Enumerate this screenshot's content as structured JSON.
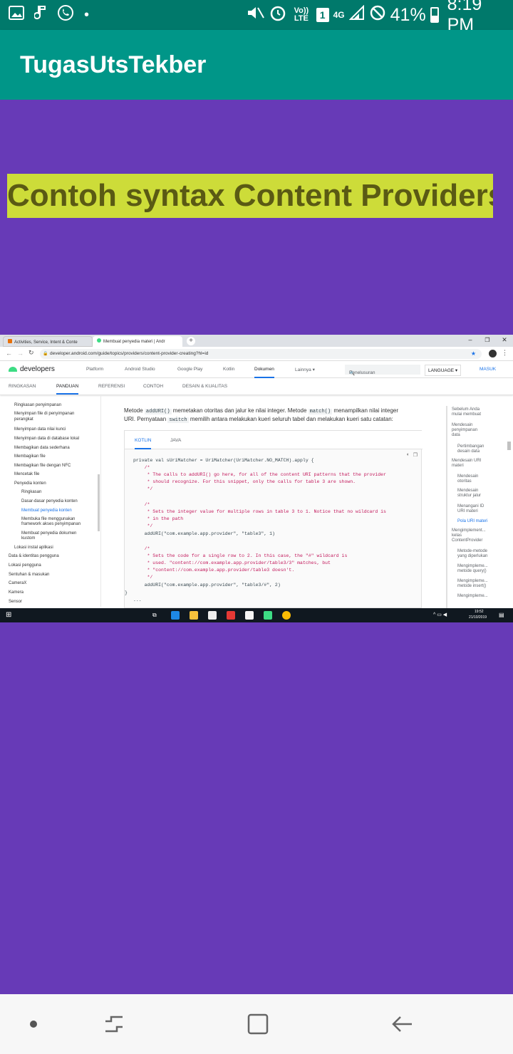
{
  "status_bar": {
    "battery": "41%",
    "time": "8:19 PM",
    "network": "4G",
    "volte": "Vo)) LTE",
    "sim": "1",
    "icons": [
      "gallery-icon",
      "music-note-icon",
      "whatsapp-icon",
      "dot-icon",
      "mute-icon",
      "alarm-icon",
      "volte-icon",
      "sim-icon",
      "signal-icon",
      "dnd-icon"
    ]
  },
  "app_bar": {
    "title": "TugasUtsTekber",
    "color": "#009688",
    "status_color": "#00796b"
  },
  "main": {
    "background": "#673ab7",
    "headline": "Contoh syntax Content Providers",
    "headline_bg": "#cddc39"
  },
  "browser": {
    "tabs": [
      {
        "label": "Activities, Service, Intent & Conte"
      },
      {
        "label": "Membuat penyedia materi | Andr"
      }
    ],
    "url": "developer.android.com/guide/topics/providers/content-provider-creating?hl=id",
    "site_nav": {
      "logo": "developers",
      "items": [
        "Platform",
        "Android Studio",
        "Google Play",
        "Kotlin",
        "Dokumen",
        "Lainnya ▾"
      ],
      "search_placeholder": "Penelusuran",
      "language": "LANGUAGE ▾",
      "signin": "MASUK"
    },
    "sub_nav": [
      "RINGKASAN",
      "PANDUAN",
      "REFERENSI",
      "CONTOH",
      "DESAIN & KUALITAS"
    ],
    "left_nav": [
      "Ringkasan penyimpanan",
      "Menyimpan file di penyimpanan",
      "perangkat",
      "Menyimpan data nilai kunci",
      "Menyimpan data di database lokal",
      "Membagikan data sederhana",
      "Membagikan file",
      "Membagikan file dengan NFC",
      "Mencetak file",
      "Penyedia konten",
      "Ringkasan",
      "Dasar-dasar penyedia konten",
      "Membuat penyedia konten",
      "Membuka file menggunakan",
      "framework akses penyimpanan",
      "Membuat penyedia dokumen",
      "kustom",
      "Lokasi instal aplikasi",
      "Data & identitas pengguna",
      "Lokasi pengguna",
      "Sentuhan & masukan",
      "CameraX",
      "Kamera",
      "Sensor"
    ],
    "content": {
      "para1_a": "Metode",
      "adduri": "addURI()",
      "para1_b": "memetakan otoritas dan jalur ke nilai integer. Metode",
      "match": "match()",
      "para1_c": "menampilkan nilai integer",
      "para2_a": "URI. Pernyataan",
      "switch": "switch",
      "para2_b": "memilih antara melakukan kueri seluruh tabel dan melakukan kueri satu catatan:",
      "code_tabs": [
        "KOTLIN",
        "JAVA"
      ],
      "code_lines": [
        "private val sUriMatcher = UriMatcher(UriMatcher.NO_MATCH).apply {",
        "    /*",
        "     * The calls to addURI() go here, for all of the content URI patterns that the provider",
        "     * should recognize. For this snippet, only the calls for table 3 are shown.",
        "     */",
        "",
        "    /*",
        "     * Sets the integer value for multiple rows in table 3 to 1. Notice that no wildcard is",
        "     * in the path",
        "     */",
        "    addURI(\"com.example.app.provider\", \"table3\", 1)",
        "",
        "    /*",
        "     * Sets the code for a single row to 2. In this case, the \"#\" wildcard is",
        "     * used. \"content://com.example.app.provider/table3/3\" matches, but",
        "     * \"content://com.example.app.provider/table3 doesn't.",
        "     */",
        "    addURI(\"com.example.app.provider\", \"table3/#\", 2)",
        "}",
        "..."
      ]
    },
    "right_nav": [
      "Sebelum Anda\nmulai membuat",
      "Mendesain\npenyimpanan\ndata",
      "Pertimbangan\ndesain data",
      "Mendesain URI\nmateri",
      "Mendesain\notoritas",
      "Mendesain\nstruktur jalur",
      "Menangani ID\nURI materi",
      "Pola URI materi",
      "Mengimplement...\nkelas\nContentProvider",
      "Metode-metode\nyang diperlukan",
      "Mengimpleme...\nmetode query()",
      "Mengimpleme...\nmetode insert()",
      "Mengimpleme..."
    ],
    "taskbar": {
      "time": "19:52",
      "date": "21/10/2019"
    }
  },
  "nav_bar": {
    "icons": [
      "dot-icon",
      "recents-icon",
      "home-icon",
      "back-icon"
    ]
  }
}
